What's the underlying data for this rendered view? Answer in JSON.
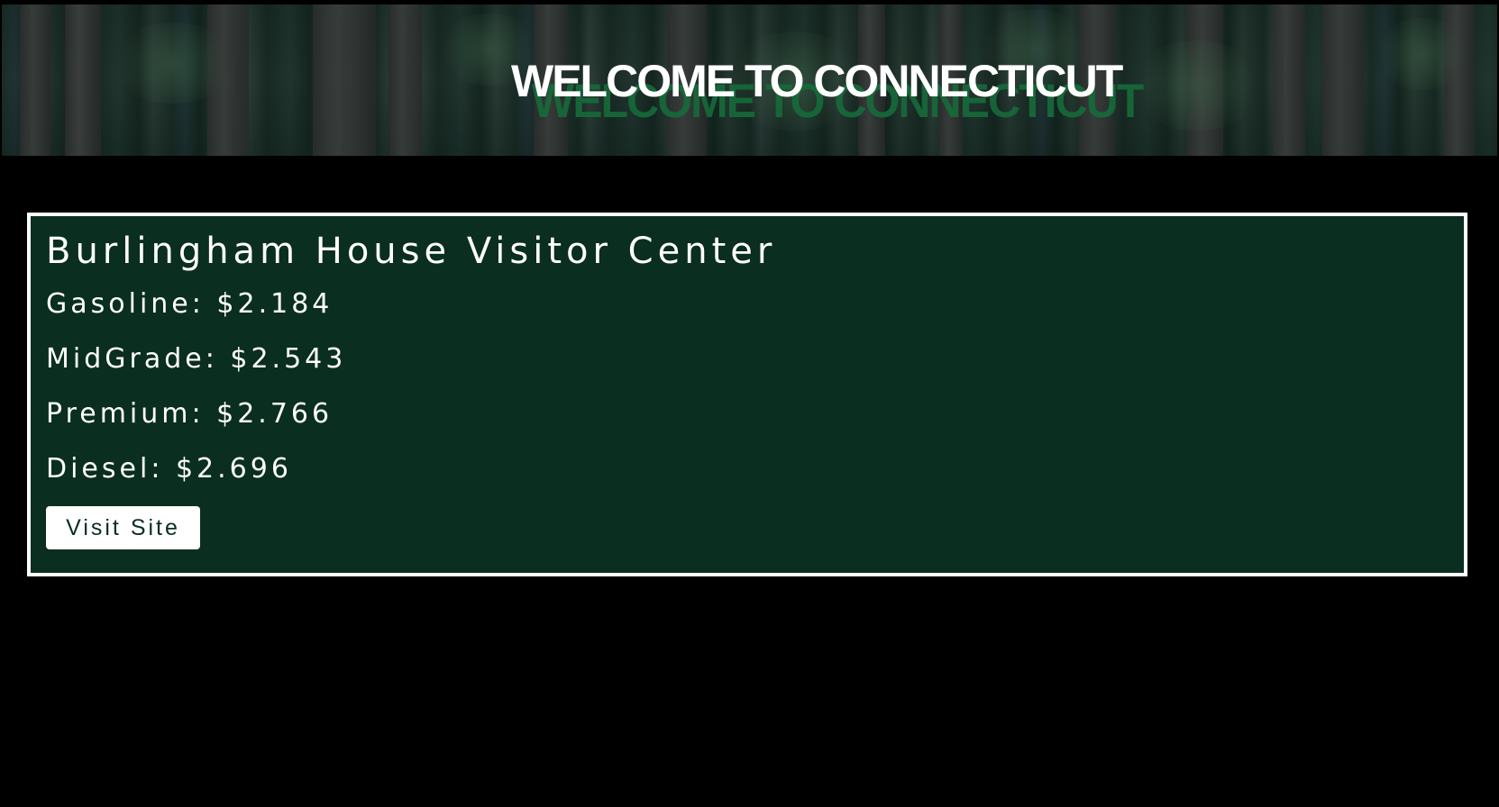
{
  "banner": {
    "title": "WELCOME TO CONNECTICUT",
    "title_color": "#ffffff",
    "shadow_color": "#166b3a"
  },
  "station": {
    "name": "Burlingham House Visitor Center",
    "prices": [
      {
        "label": "Gasoline: $2.184"
      },
      {
        "label": "MidGrade: $2.543"
      },
      {
        "label": "Premium: $2.766"
      },
      {
        "label": "Diesel: $2.696"
      }
    ],
    "visit_button_label": "Visit Site",
    "card_background": "#0a2e1f",
    "card_border": "#ffffff"
  }
}
